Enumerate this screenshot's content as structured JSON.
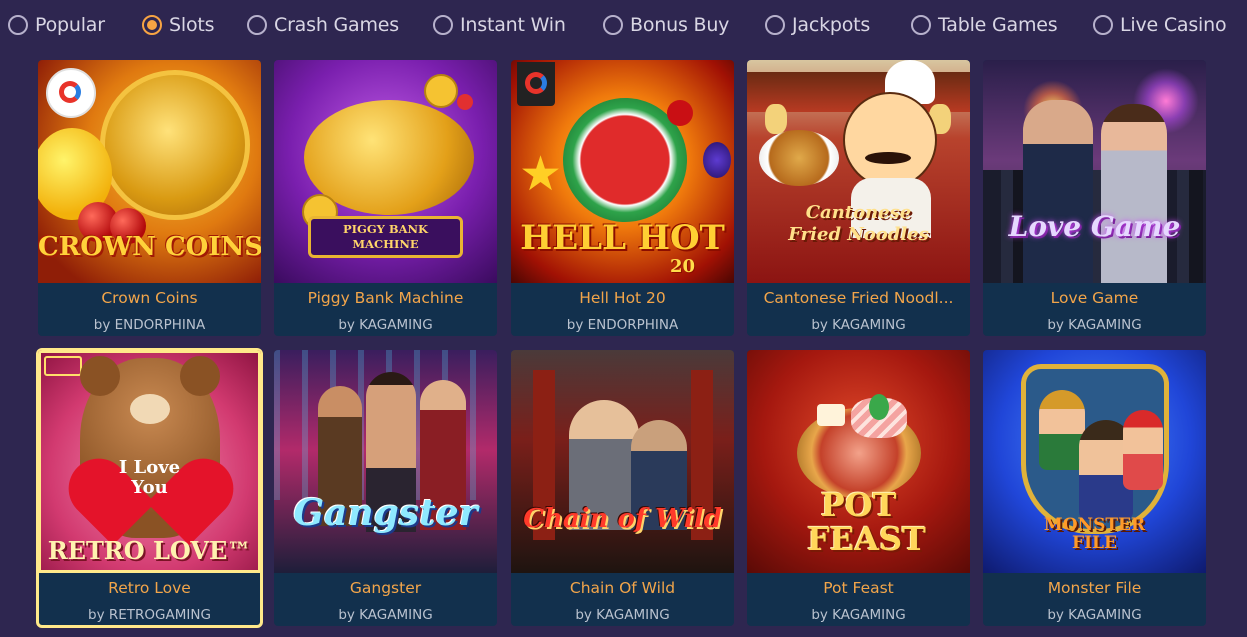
{
  "filters": [
    {
      "label": "Popular",
      "selected": false
    },
    {
      "label": "Slots",
      "selected": true
    },
    {
      "label": "Crash Games",
      "selected": false
    },
    {
      "label": "Instant Win",
      "selected": false
    },
    {
      "label": "Bonus Buy",
      "selected": false
    },
    {
      "label": "Jackpots",
      "selected": false
    },
    {
      "label": "Table Games",
      "selected": false
    },
    {
      "label": "Live Casino",
      "selected": false
    }
  ],
  "games": [
    {
      "title": "Crown Coins",
      "provider": "by ENDORPHINA",
      "thumb_text": "CROWN COINS"
    },
    {
      "title": "Piggy Bank Machine",
      "provider": "by KAGAMING",
      "thumb_text": "PIGGY BANK MACHINE"
    },
    {
      "title": "Hell Hot 20",
      "provider": "by ENDORPHINA",
      "thumb_text": "HELL HOT",
      "thumb_sub": "20"
    },
    {
      "title": "Cantonese Fried Noodl...",
      "provider": "by KAGAMING",
      "thumb_text": "Cantonese Fried Noodles"
    },
    {
      "title": "Love Game",
      "provider": "by KAGAMING",
      "thumb_text": "Love Game"
    },
    {
      "title": "Retro Love",
      "provider": "by RETROGAMING",
      "thumb_text": "RETRO LOVE™",
      "thumb_sub": "I Love You"
    },
    {
      "title": "Gangster",
      "provider": "by KAGAMING",
      "thumb_text": "Gangster"
    },
    {
      "title": "Chain Of Wild",
      "provider": "by KAGAMING",
      "thumb_text": "Chain of Wild"
    },
    {
      "title": "Pot Feast",
      "provider": "by KAGAMING",
      "thumb_text": "POT FEAST"
    },
    {
      "title": "Monster File",
      "provider": "by KAGAMING",
      "thumb_text": "MONSTER FILE"
    }
  ],
  "colors": {
    "background": "#2e2650",
    "accent": "#f7a443",
    "card": "#12304d",
    "title": "#f2a54a"
  }
}
